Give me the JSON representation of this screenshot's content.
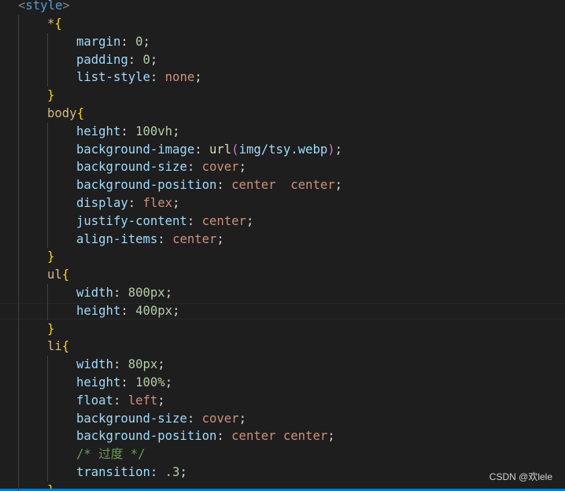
{
  "editor": {
    "lines": [
      {
        "tokens": [
          {
            "t": "<",
            "c": "bracket-tag"
          },
          {
            "t": "style",
            "c": "tag"
          },
          {
            "t": ">",
            "c": "bracket-tag"
          }
        ],
        "indent": 0
      },
      {
        "tokens": [
          {
            "t": "*",
            "c": "sel"
          },
          {
            "t": "{",
            "c": "brace"
          }
        ],
        "indent": 1
      },
      {
        "tokens": [
          {
            "t": "margin",
            "c": "prop"
          },
          {
            "t": ": ",
            "c": "punc"
          },
          {
            "t": "0",
            "c": "num"
          },
          {
            "t": ";",
            "c": "punc"
          }
        ],
        "indent": 2
      },
      {
        "tokens": [
          {
            "t": "padding",
            "c": "prop"
          },
          {
            "t": ": ",
            "c": "punc"
          },
          {
            "t": "0",
            "c": "num"
          },
          {
            "t": ";",
            "c": "punc"
          }
        ],
        "indent": 2
      },
      {
        "tokens": [
          {
            "t": "list-style",
            "c": "prop"
          },
          {
            "t": ": ",
            "c": "punc"
          },
          {
            "t": "none",
            "c": "val"
          },
          {
            "t": ";",
            "c": "punc"
          }
        ],
        "indent": 2
      },
      {
        "tokens": [
          {
            "t": "}",
            "c": "brace"
          }
        ],
        "indent": 1
      },
      {
        "tokens": [
          {
            "t": "body",
            "c": "sel"
          },
          {
            "t": "{",
            "c": "brace"
          }
        ],
        "indent": 1
      },
      {
        "tokens": [
          {
            "t": "height",
            "c": "prop"
          },
          {
            "t": ": ",
            "c": "punc"
          },
          {
            "t": "100vh",
            "c": "num"
          },
          {
            "t": ";",
            "c": "punc"
          }
        ],
        "indent": 2
      },
      {
        "tokens": [
          {
            "t": "background-image",
            "c": "prop"
          },
          {
            "t": ": ",
            "c": "punc"
          },
          {
            "t": "url",
            "c": "func"
          },
          {
            "t": "(",
            "c": "paren"
          },
          {
            "t": "img/tsy.webp",
            "c": "str"
          },
          {
            "t": ")",
            "c": "paren"
          },
          {
            "t": ";",
            "c": "punc"
          }
        ],
        "indent": 2
      },
      {
        "tokens": [
          {
            "t": "background-size",
            "c": "prop"
          },
          {
            "t": ": ",
            "c": "punc"
          },
          {
            "t": "cover",
            "c": "val"
          },
          {
            "t": ";",
            "c": "punc"
          }
        ],
        "indent": 2
      },
      {
        "tokens": [
          {
            "t": "background-position",
            "c": "prop"
          },
          {
            "t": ": ",
            "c": "punc"
          },
          {
            "t": "center  center",
            "c": "val"
          },
          {
            "t": ";",
            "c": "punc"
          }
        ],
        "indent": 2
      },
      {
        "tokens": [
          {
            "t": "display",
            "c": "prop"
          },
          {
            "t": ": ",
            "c": "punc"
          },
          {
            "t": "flex",
            "c": "val"
          },
          {
            "t": ";",
            "c": "punc"
          }
        ],
        "indent": 2
      },
      {
        "tokens": [
          {
            "t": "justify-content",
            "c": "prop"
          },
          {
            "t": ": ",
            "c": "punc"
          },
          {
            "t": "center",
            "c": "val"
          },
          {
            "t": ";",
            "c": "punc"
          }
        ],
        "indent": 2
      },
      {
        "tokens": [
          {
            "t": "align-items",
            "c": "prop"
          },
          {
            "t": ": ",
            "c": "punc"
          },
          {
            "t": "center",
            "c": "val"
          },
          {
            "t": ";",
            "c": "punc"
          }
        ],
        "indent": 2
      },
      {
        "tokens": [
          {
            "t": "}",
            "c": "brace"
          }
        ],
        "indent": 1
      },
      {
        "tokens": [
          {
            "t": "ul",
            "c": "sel"
          },
          {
            "t": "{",
            "c": "brace"
          }
        ],
        "indent": 1
      },
      {
        "tokens": [
          {
            "t": "width",
            "c": "prop"
          },
          {
            "t": ": ",
            "c": "punc"
          },
          {
            "t": "800px",
            "c": "num"
          },
          {
            "t": ";",
            "c": "punc"
          }
        ],
        "indent": 2
      },
      {
        "tokens": [
          {
            "t": "height",
            "c": "prop"
          },
          {
            "t": ": ",
            "c": "punc"
          },
          {
            "t": "400px",
            "c": "num"
          },
          {
            "t": ";",
            "c": "punc"
          }
        ],
        "indent": 2
      },
      {
        "tokens": [
          {
            "t": "}",
            "c": "brace"
          }
        ],
        "indent": 1
      },
      {
        "tokens": [
          {
            "t": "li",
            "c": "sel"
          },
          {
            "t": "{",
            "c": "brace"
          }
        ],
        "indent": 1
      },
      {
        "tokens": [
          {
            "t": "width",
            "c": "prop"
          },
          {
            "t": ": ",
            "c": "punc"
          },
          {
            "t": "80px",
            "c": "num"
          },
          {
            "t": ";",
            "c": "punc"
          }
        ],
        "indent": 2
      },
      {
        "tokens": [
          {
            "t": "height",
            "c": "prop"
          },
          {
            "t": ": ",
            "c": "punc"
          },
          {
            "t": "100%",
            "c": "num"
          },
          {
            "t": ";",
            "c": "punc"
          }
        ],
        "indent": 2
      },
      {
        "tokens": [
          {
            "t": "float",
            "c": "prop"
          },
          {
            "t": ": ",
            "c": "punc"
          },
          {
            "t": "left",
            "c": "val"
          },
          {
            "t": ";",
            "c": "punc"
          }
        ],
        "indent": 2
      },
      {
        "tokens": [
          {
            "t": "background-size",
            "c": "prop"
          },
          {
            "t": ": ",
            "c": "punc"
          },
          {
            "t": "cover",
            "c": "val"
          },
          {
            "t": ";",
            "c": "punc"
          }
        ],
        "indent": 2
      },
      {
        "tokens": [
          {
            "t": "background-position",
            "c": "prop"
          },
          {
            "t": ": ",
            "c": "punc"
          },
          {
            "t": "center center",
            "c": "val"
          },
          {
            "t": ";",
            "c": "punc"
          }
        ],
        "indent": 2
      },
      {
        "tokens": [
          {
            "t": "/* 过度 */",
            "c": "comment"
          }
        ],
        "indent": 2
      },
      {
        "tokens": [
          {
            "t": "transition",
            "c": "prop"
          },
          {
            "t": ": ",
            "c": "punc"
          },
          {
            "t": ".3",
            "c": "num"
          },
          {
            "t": ";",
            "c": "punc"
          }
        ],
        "indent": 2
      },
      {
        "tokens": [
          {
            "t": "}",
            "c": "brace"
          }
        ],
        "indent": 1
      }
    ],
    "current_line_index": 17
  },
  "watermark": {
    "text": "CSDN @欢lele"
  }
}
